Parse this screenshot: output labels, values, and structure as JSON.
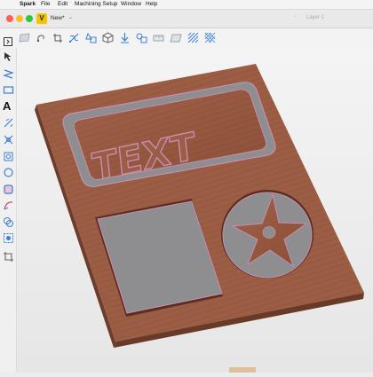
{
  "menu": {
    "apple": "",
    "app": "Spark",
    "items": [
      "File",
      "Edit",
      "Machining Setup",
      "Window",
      "Help"
    ]
  },
  "document": {
    "name": "New*",
    "layer_placeholder": "Layer 1",
    "icon_letter": "V"
  },
  "design": {
    "text": "TEXT",
    "board_color": "#9a5c42",
    "pocket_color": "#8e8e90",
    "edge_color": "#c48fb0"
  },
  "colors": {
    "close": "#fe5f57",
    "minimize": "#febc2e",
    "zoom": "#28c840",
    "accent": "#3d7fd6"
  },
  "toolbar_icons": [
    "frame-icon",
    "node-edit-icon",
    "crop-icon",
    "transform-icon",
    "shape-icon",
    "box-view-icon",
    "join-icon",
    "group-icon",
    "measure-icon",
    "plane-icon",
    "hatch-icon",
    "grid-hatch-icon"
  ],
  "sidebar_icons": [
    "toggle-panel-icon",
    "select-icon",
    "polyline-icon",
    "rectangle-icon",
    "text-icon",
    "path-icon",
    "offset-icon",
    "edit-nodes-icon",
    "circle-icon",
    "rounded-rect-icon",
    "curve-icon",
    "weld-icon",
    "boolean-icon",
    "crop-tool-icon"
  ]
}
